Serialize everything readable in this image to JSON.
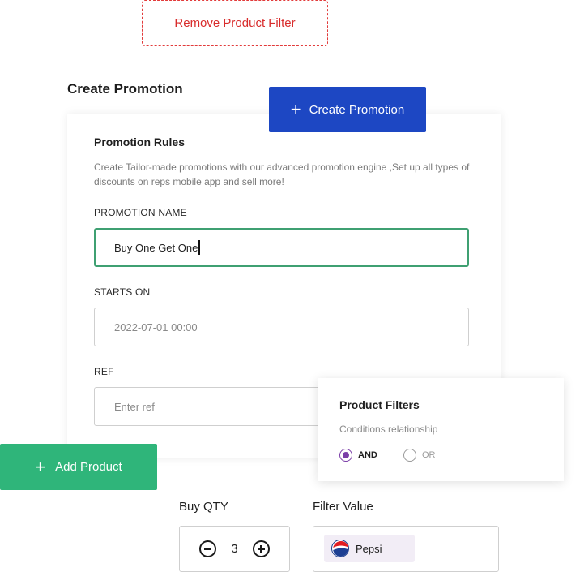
{
  "remove_filter_label": "Remove Product Filter",
  "section_title": "Create Promotion",
  "create_button_label": "Create Promotion",
  "rules": {
    "title": "Promotion Rules",
    "description": "Create Tailor-made promotions with our advanced promotion engine ,Set up all types of discounts on reps mobile app and sell more!"
  },
  "fields": {
    "name_label": "PROMOTION NAME",
    "name_value": "Buy One Get One",
    "starts_label": "STARTS ON",
    "starts_value": "2022-07-01 00:00",
    "ref_label": "REF",
    "ref_placeholder": "Enter ref"
  },
  "product_filters": {
    "title": "Product Filters",
    "subtitle": "Conditions relationship",
    "options": [
      "AND",
      "OR"
    ],
    "selected": "AND"
  },
  "add_product_label": "Add Product",
  "buy_qty": {
    "label": "Buy QTY",
    "value": "3"
  },
  "filter_value": {
    "label": "Filter Value",
    "chip": "Pepsi",
    "chip_icon": "pepsi-logo-icon"
  },
  "colors": {
    "primary_blue": "#1d47c3",
    "green": "#2fb57a",
    "danger": "#d82c2c",
    "focus_border": "#3fa072",
    "radio_purple": "#7b3ea8"
  }
}
